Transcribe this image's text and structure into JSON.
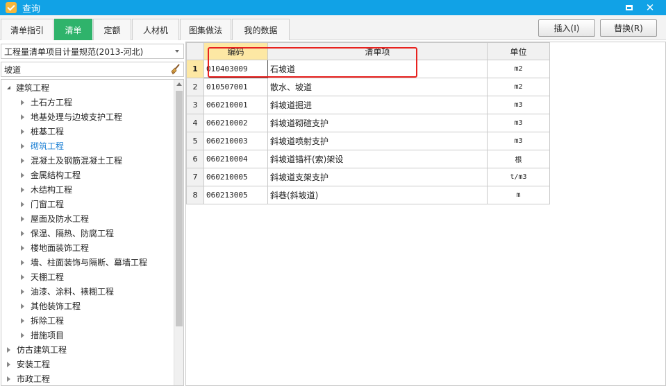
{
  "window": {
    "title": "查询"
  },
  "tabs": [
    {
      "label": "清单指引"
    },
    {
      "label": "清单"
    },
    {
      "label": "定额"
    },
    {
      "label": "人材机"
    },
    {
      "label": "图集做法"
    },
    {
      "label": "我的数据"
    }
  ],
  "active_tab": "清单",
  "toolbar": {
    "insert_label": "插入(I)",
    "replace_label": "替换(R)"
  },
  "left": {
    "spec_select": "工程量清单项目计量规范(2013-河北)",
    "search_value": "坡道",
    "tree": [
      {
        "label": "建筑工程",
        "level": 0,
        "expanded": true
      },
      {
        "label": "土石方工程",
        "level": 1
      },
      {
        "label": "地基处理与边坡支护工程",
        "level": 1
      },
      {
        "label": "桩基工程",
        "level": 1
      },
      {
        "label": "砌筑工程",
        "level": 1,
        "selected": true
      },
      {
        "label": "混凝土及钢筋混凝土工程",
        "level": 1
      },
      {
        "label": "金属结构工程",
        "level": 1
      },
      {
        "label": "木结构工程",
        "level": 1
      },
      {
        "label": "门窗工程",
        "level": 1
      },
      {
        "label": "屋面及防水工程",
        "level": 1
      },
      {
        "label": "保温、隔热、防腐工程",
        "level": 1
      },
      {
        "label": "楼地面装饰工程",
        "level": 1
      },
      {
        "label": "墙、柱面装饰与隔断、幕墙工程",
        "level": 1
      },
      {
        "label": "天棚工程",
        "level": 1
      },
      {
        "label": "油漆、涂料、裱糊工程",
        "level": 1
      },
      {
        "label": "其他装饰工程",
        "level": 1
      },
      {
        "label": "拆除工程",
        "level": 1
      },
      {
        "label": "措施项目",
        "level": 1
      },
      {
        "label": "仿古建筑工程",
        "level": 0,
        "expanded": false
      },
      {
        "label": "安装工程",
        "level": 0,
        "expanded": false
      },
      {
        "label": "市政工程",
        "level": 0,
        "expanded": false
      }
    ]
  },
  "grid": {
    "headers": {
      "code": "编码",
      "name": "清单项",
      "unit": "单位"
    },
    "rows": [
      {
        "no": "1",
        "code": "010403009",
        "name": "石坡道",
        "unit": "m2"
      },
      {
        "no": "2",
        "code": "010507001",
        "name": "散水、坡道",
        "unit": "m2"
      },
      {
        "no": "3",
        "code": "060210001",
        "name": "斜坡道掘进",
        "unit": "m3"
      },
      {
        "no": "4",
        "code": "060210002",
        "name": "斜坡道砌碹支护",
        "unit": "m3"
      },
      {
        "no": "5",
        "code": "060210003",
        "name": "斜坡道喷射支护",
        "unit": "m3"
      },
      {
        "no": "6",
        "code": "060210004",
        "name": "斜坡道锚杆(索)架设",
        "unit": "根"
      },
      {
        "no": "7",
        "code": "060210005",
        "name": "斜坡道支架支护",
        "unit": "t/m3"
      },
      {
        "no": "8",
        "code": "060213005",
        "name": "斜巷(斜坡道)",
        "unit": "m"
      }
    ]
  },
  "colors": {
    "titlebar": "#11a2e6",
    "active_tab": "#2fb36b",
    "highlight": "#e8221f",
    "header_highlight": "#fde8a4"
  }
}
